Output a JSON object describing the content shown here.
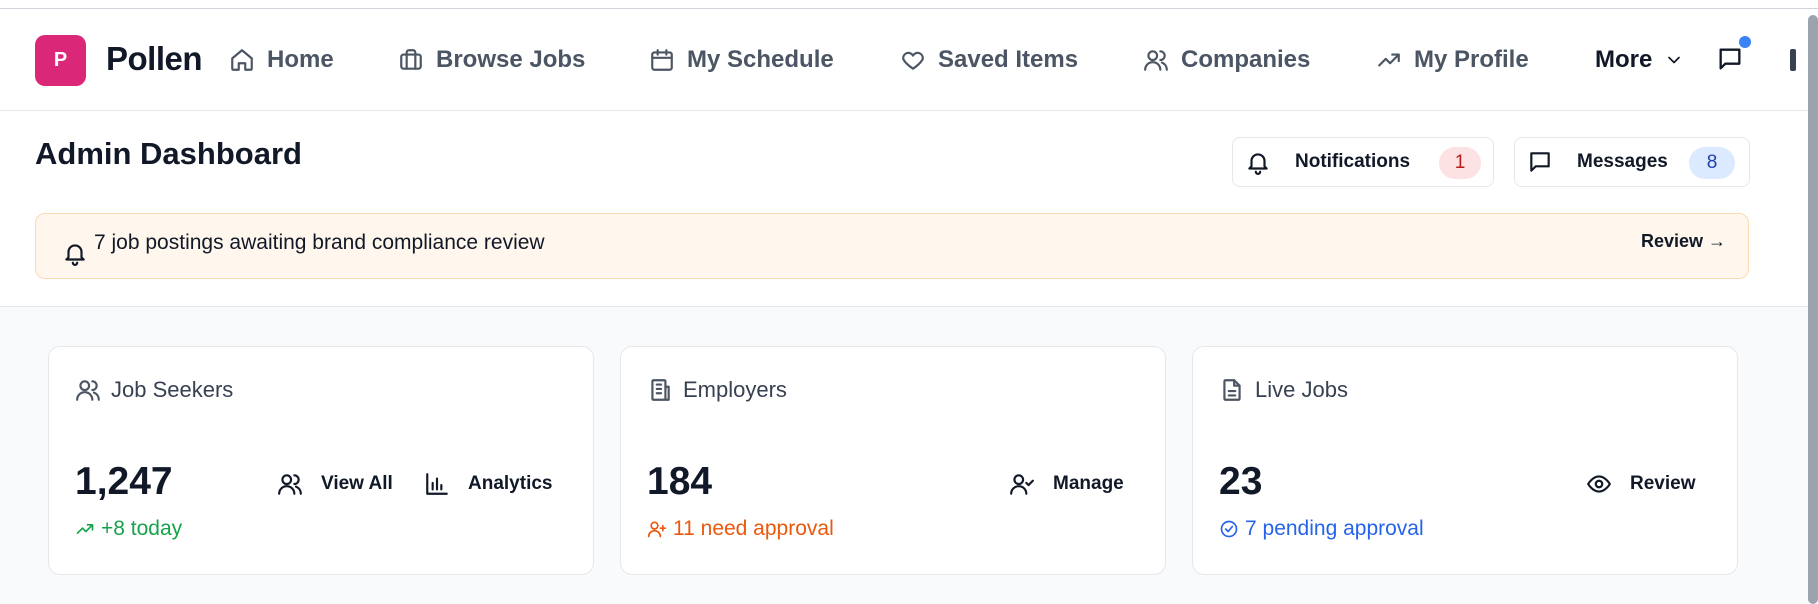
{
  "header": {
    "logo_letter": "P",
    "brand": "Pollen",
    "nav": [
      {
        "label": "Home",
        "icon": "home-icon"
      },
      {
        "label": "Browse Jobs",
        "icon": "briefcase-icon"
      },
      {
        "label": "My Schedule",
        "icon": "calendar-icon"
      },
      {
        "label": "Saved Items",
        "icon": "heart-icon"
      },
      {
        "label": "Companies",
        "icon": "users-icon"
      },
      {
        "label": "My Profile",
        "icon": "trending-up-icon"
      }
    ],
    "more_label": "More"
  },
  "dashboard": {
    "title": "Admin Dashboard",
    "notifications": {
      "label": "Notifications",
      "count": "1",
      "badge_bg": "#fde2e4",
      "badge_color": "#b91c1c"
    },
    "messages": {
      "label": "Messages",
      "count": "8",
      "badge_bg": "#dbeafe",
      "badge_color": "#1e40af"
    }
  },
  "alert": {
    "text": "7 job postings awaiting brand compliance review",
    "action": "Review →"
  },
  "cards": [
    {
      "title": "Job Seekers",
      "value": "1,247",
      "sub": "+8 today",
      "sub_color": "#16a34a",
      "actions": [
        "View All",
        "Analytics"
      ]
    },
    {
      "title": "Employers",
      "value": "184",
      "sub": "11 need approval",
      "sub_color": "#ea580c",
      "actions": [
        "Manage"
      ]
    },
    {
      "title": "Live Jobs",
      "value": "23",
      "sub": "7 pending approval",
      "sub_color": "#2563eb",
      "actions": [
        "Review"
      ]
    }
  ],
  "colors": {
    "brand": "#db2777",
    "notify_dot": "#3b82f6"
  }
}
